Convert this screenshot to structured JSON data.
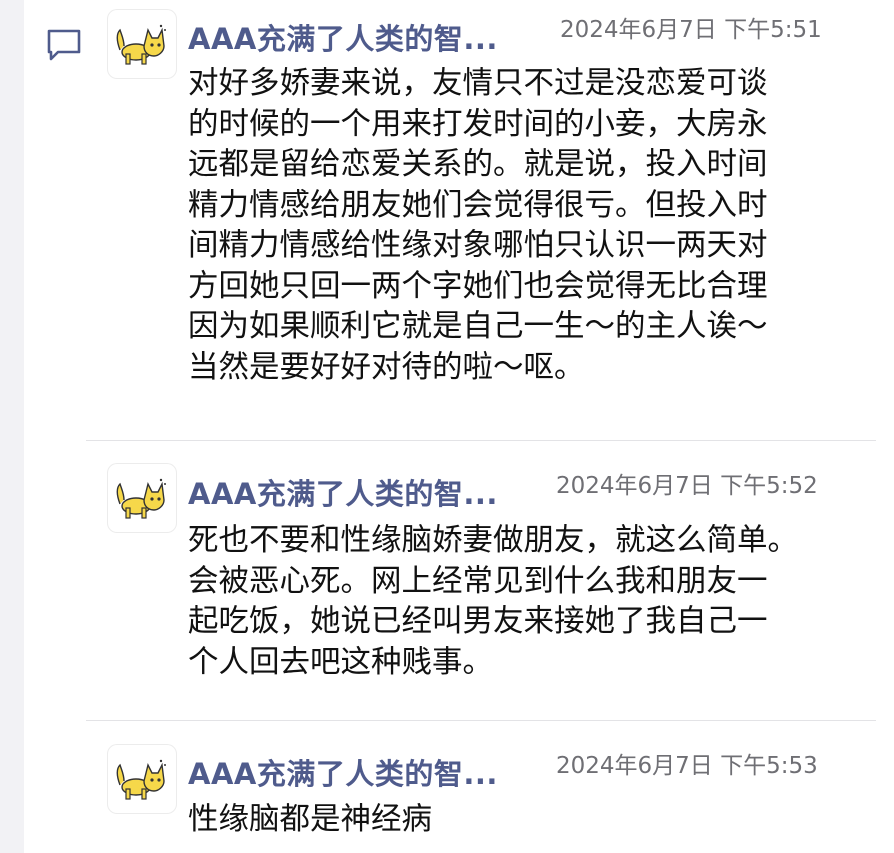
{
  "thread": {
    "icon": "comment-icon",
    "accent_color": "#4f5b8c",
    "avatar_icon": "yellow-cat-icon",
    "comments": [
      {
        "author": "AAA充满了人类的智...",
        "time": "2024年6月7日 下午5:51",
        "lines": [
          "对好多娇妻来说，友情只不过是没恋爱可谈",
          "的时候的一个用来打发时间的小妾，大房永",
          "远都是留给恋爱关系的。就是说，投入时间",
          "精力情感给朋友她们会觉得很亏。但投入时",
          "间精力情感给性缘对象哪怕只认识一两天对",
          "方回她只回一两个字她们也会觉得无比合理",
          "因为如果顺利它就是自己一生～的主人诶～",
          "当然是要好好对待的啦～呕。"
        ]
      },
      {
        "author": "AAA充满了人类的智...",
        "time": "2024年6月7日 下午5:52",
        "lines": [
          "死也不要和性缘脑娇妻做朋友，就这么简单。",
          "会被恶心死。网上经常见到什么我和朋友一",
          "起吃饭，她说已经叫男友来接她了我自己一",
          "个人回去吧这种贱事。"
        ]
      },
      {
        "author": "AAA充满了人类的智...",
        "time": "2024年6月7日 下午5:53",
        "lines": [
          "性缘脑都是神经病"
        ]
      }
    ]
  }
}
